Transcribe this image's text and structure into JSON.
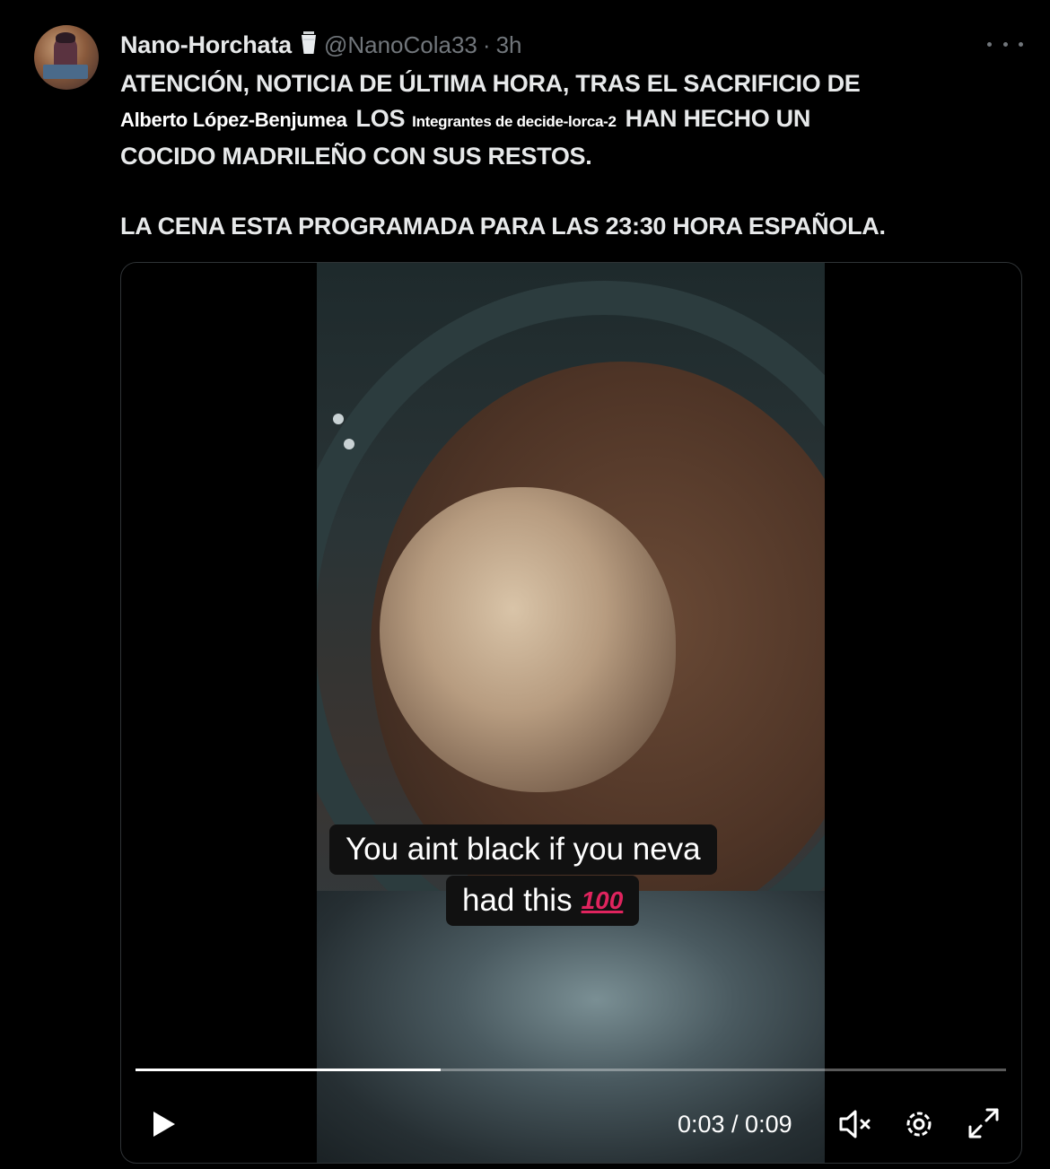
{
  "author": {
    "display_name": "Nano-Horchata",
    "handle": "@NanoCola33",
    "separator": "·",
    "time": "3h",
    "badge_icon": "cup-icon"
  },
  "tweet": {
    "line1": "ATENCIÓN, NOTICIA DE ÚLTIMA HORA, TRAS EL SACRIFICIO DE",
    "mention_name": "Alberto López-Benjumea",
    "los": "LOS",
    "mention_group": "Integrantes de decide-lorca-2",
    "line2_end": "HAN HECHO UN",
    "line3": "COCIDO MADRILEÑO CON SUS RESTOS.",
    "line4": "LA CENA ESTA PROGRAMADA PARA LAS 23:30 HORA ESPAÑOLA."
  },
  "video": {
    "caption_line1": "You aint black if you neva",
    "caption_line2": "had this",
    "caption_emoji": "100",
    "time_display": "0:03 / 0:09",
    "progress": 0.35,
    "controls": [
      "play-icon",
      "mute-icon",
      "gear-icon",
      "expand-icon"
    ]
  },
  "colors": {
    "background": "#000000",
    "text": "#e7e9ea",
    "muted": "#71767b",
    "border": "#2f3336"
  }
}
